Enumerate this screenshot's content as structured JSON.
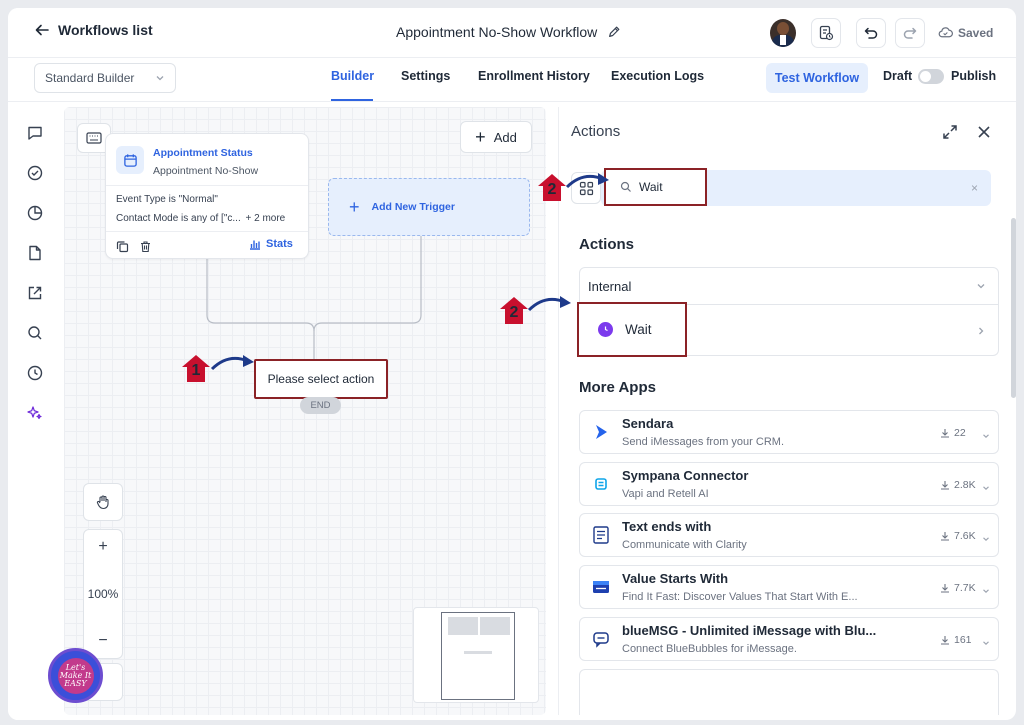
{
  "topbar": {
    "back_label": "Workflows list",
    "workflow_title": "Appointment No-Show Workflow",
    "saved_label": "Saved"
  },
  "subbar": {
    "builder_select": "Standard Builder",
    "tabs": [
      {
        "label": "Builder",
        "active": true
      },
      {
        "label": "Settings",
        "active": false
      },
      {
        "label": "Enrollment History",
        "active": false
      },
      {
        "label": "Execution Logs",
        "active": false
      }
    ],
    "test_workflow": "Test Workflow",
    "draft": "Draft",
    "publish": "Publish"
  },
  "canvas": {
    "add_label": "Add",
    "trigger": {
      "title": "Appointment Status",
      "subtitle": "Appointment No-Show",
      "line1": "Event Type is \"Normal\"",
      "line2": "Contact Mode is any of [\"c...",
      "line2_more": "+ 2 more",
      "stats_label": "Stats"
    },
    "add_new_trigger": "Add New Trigger",
    "select_action": "Please select action",
    "end_label": "END",
    "zoom_level": "100%",
    "zoom_in": "+",
    "zoom_out": "−"
  },
  "annotations": {
    "badge_1": "1",
    "badge_2a": "2",
    "badge_2b": "2",
    "color": "#c8102e"
  },
  "logo": {
    "text": "Let's Make It EASY"
  },
  "actions_panel": {
    "title": "Actions",
    "search_value": "Wait",
    "search_clear": "×",
    "section_actions": "Actions",
    "internal_label": "Internal",
    "wait_label": "Wait",
    "section_more_apps": "More Apps",
    "apps": [
      {
        "name": "Sendara",
        "desc": "Send iMessages from your CRM.",
        "count": "22",
        "icon": "sendara-arrow-icon"
      },
      {
        "name": "Sympana Connector",
        "desc": "Vapi and Retell AI",
        "count": "2.8K",
        "icon": "sympana-icon"
      },
      {
        "name": "Text ends with",
        "desc": "Communicate with Clarity",
        "count": "7.6K",
        "icon": "text-doc-icon"
      },
      {
        "name": "Value Starts With",
        "desc": "Find It Fast: Discover Values That Start With E...",
        "count": "7.7K",
        "icon": "value-icon"
      },
      {
        "name": "blueMSG - Unlimited iMessage with Blu...",
        "desc": "Connect BlueBubbles for iMessage.",
        "count": "161",
        "icon": "bluemsg-icon"
      }
    ]
  },
  "colors": {
    "accent": "#2f64e0",
    "accent_bg": "#e6effd",
    "highlight_border": "#8b2226"
  }
}
